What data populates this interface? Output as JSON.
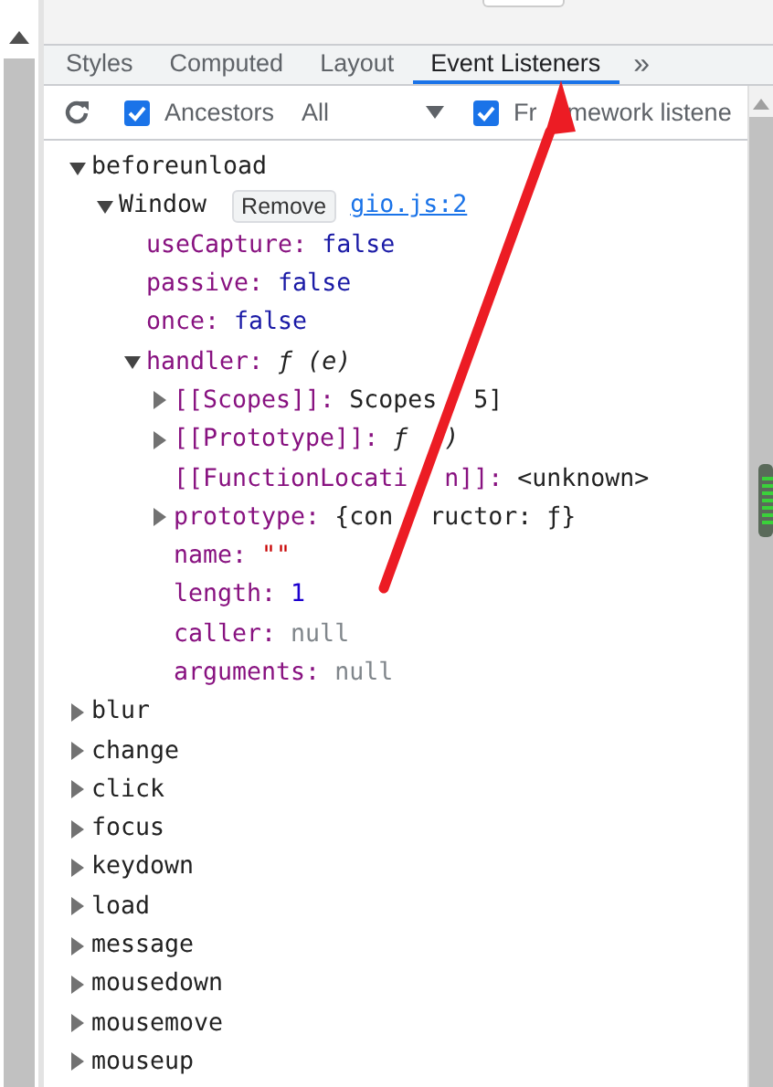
{
  "tabs": [
    {
      "label": "Styles",
      "selected": false
    },
    {
      "label": "Computed",
      "selected": false
    },
    {
      "label": "Layout",
      "selected": false
    },
    {
      "label": "Event Listeners",
      "selected": true
    }
  ],
  "overflow_tabs": "»",
  "toolbar": {
    "ancestors": {
      "label": "Ancestors",
      "checked": true
    },
    "filter": {
      "value": "All"
    },
    "framework": {
      "label": [
        "Fr",
        "mework listene"
      ],
      "checked": true
    }
  },
  "tree": [
    {
      "kind": "event",
      "name": "beforeunload",
      "expanded": true,
      "children": [
        {
          "kind": "listener",
          "name": "Window",
          "expanded": true,
          "button": "Remove",
          "link": "gio.js:2",
          "children": [
            {
              "kind": "property",
              "name": "useCapture:",
              "value": "false",
              "color": "#1a1aa6"
            },
            {
              "kind": "property",
              "name": "passive:",
              "value": "false",
              "color": "#1a1aa6"
            },
            {
              "kind": "property",
              "name": "once:",
              "value": "false",
              "color": "#1a1aa6"
            },
            {
              "kind": "method",
              "name": "handler:",
              "value": "ƒ (e)",
              "color": "#222222",
              "expanded": true,
              "children": [
                {
                  "kind": "property",
                  "name": "[[Scopes]]:",
                  "value": [
                    "Scopes",
                    "5]"
                  ],
                  "color": "#222222",
                  "expanded": false
                },
                {
                  "kind": "method",
                  "name": "[[Prototype]]:",
                  "value": [
                    "ƒ",
                    ")"
                  ],
                  "color": "#222222",
                  "expanded": false
                },
                {
                  "kind": "property",
                  "name": [
                    "[[FunctionLocati",
                    "n]]:"
                  ],
                  "value": "<unknown>",
                  "color": "#222222"
                },
                {
                  "kind": "property",
                  "name": "prototype:",
                  "value": [
                    "{con",
                    "ructor: ƒ}"
                  ],
                  "color": "#222222",
                  "expanded": false
                },
                {
                  "kind": "property",
                  "name": "name:",
                  "value": "\"\"",
                  "color": "#c80000"
                },
                {
                  "kind": "property",
                  "name": "length:",
                  "value": "1",
                  "color": "#1c00cf"
                },
                {
                  "kind": "property",
                  "name": "caller:",
                  "value": "null",
                  "color": "#80868b"
                },
                {
                  "kind": "property",
                  "name": "arguments:",
                  "value": "null",
                  "color": "#80868b"
                }
              ]
            }
          ]
        }
      ]
    },
    {
      "kind": "event",
      "name": "blur",
      "expanded": false
    },
    {
      "kind": "event",
      "name": "change",
      "expanded": false
    },
    {
      "kind": "event",
      "name": "click",
      "expanded": false
    },
    {
      "kind": "event",
      "name": "focus",
      "expanded": false
    },
    {
      "kind": "event",
      "name": "keydown",
      "expanded": false
    },
    {
      "kind": "event",
      "name": "load",
      "expanded": false
    },
    {
      "kind": "event",
      "name": "message",
      "expanded": false
    },
    {
      "kind": "event",
      "name": "mousedown",
      "expanded": false
    },
    {
      "kind": "event",
      "name": "mousemove",
      "expanded": false
    },
    {
      "kind": "event",
      "name": "mouseup",
      "expanded": false
    }
  ]
}
